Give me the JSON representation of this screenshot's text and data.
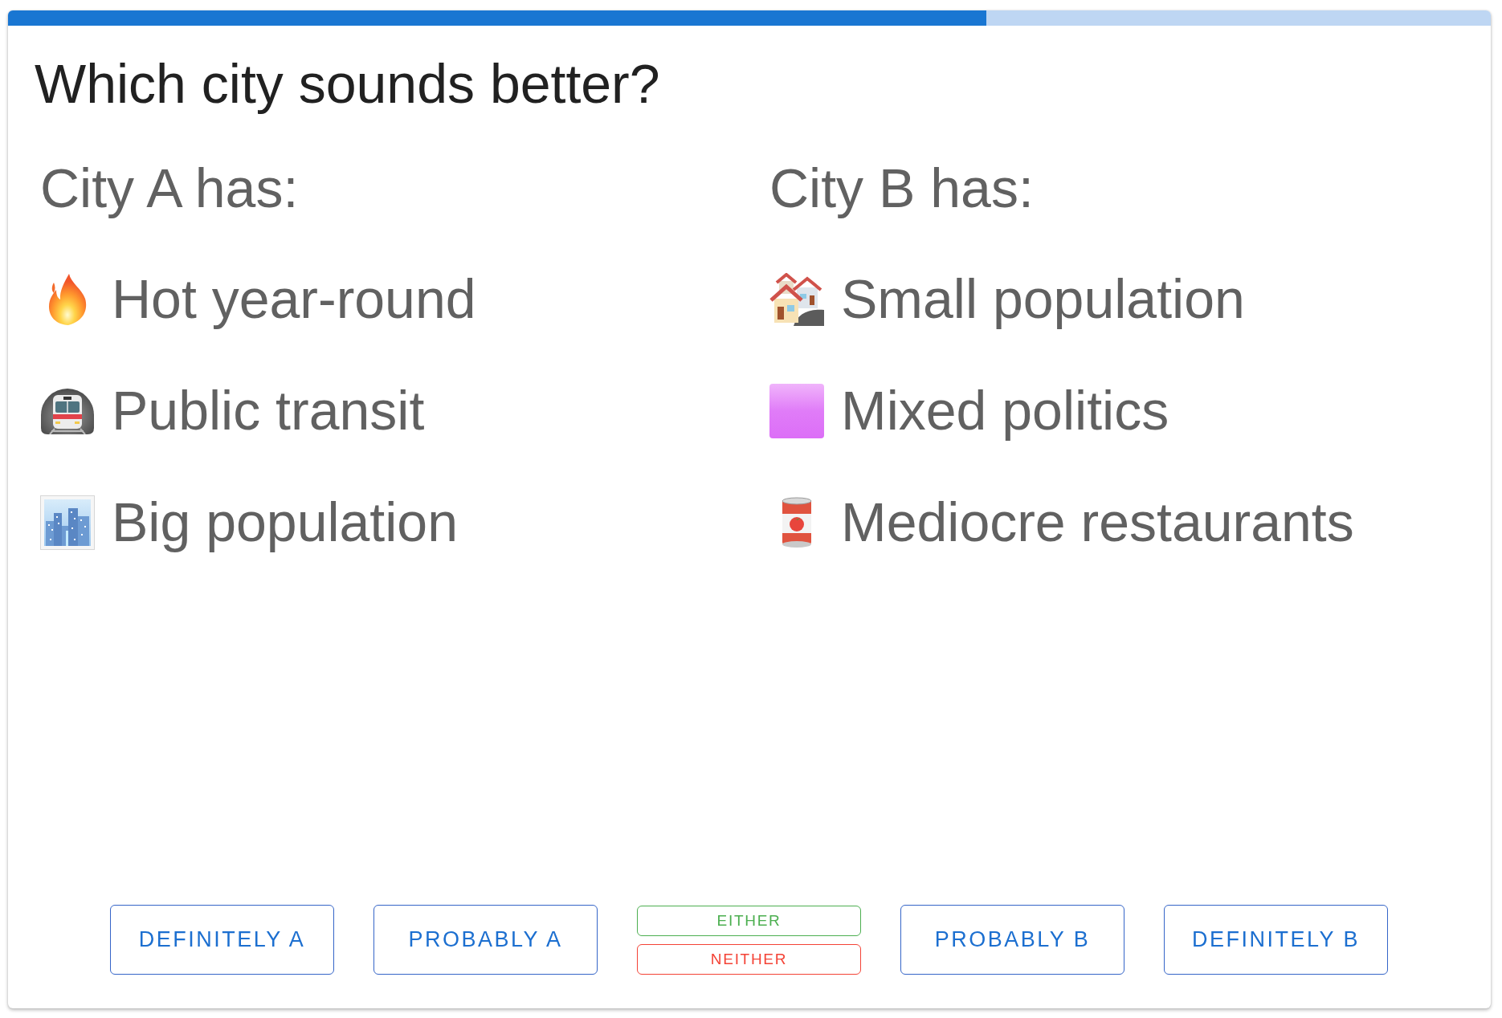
{
  "progress": {
    "level": 0.66
  },
  "question": "Which city sounds better?",
  "options": [
    {
      "heading": "City A has:",
      "traits": [
        {
          "kind": "fire",
          "label": "Hot year-round"
        },
        {
          "kind": "train",
          "label": "Public transit"
        },
        {
          "kind": "city",
          "label": "Big population"
        }
      ]
    },
    {
      "heading": "City B has:",
      "traits": [
        {
          "kind": "houses",
          "label": "Small population"
        },
        {
          "kind": "square",
          "label": "Mixed politics"
        },
        {
          "kind": "can",
          "label": "Mediocre restaurants"
        }
      ]
    }
  ],
  "answers": [
    {
      "kind": "main",
      "label": "DEFINITELY A"
    },
    {
      "kind": "main",
      "label": "PROBABLY A"
    },
    {
      "kind": "pair",
      "items": [
        {
          "label": "EITHER",
          "color": "#4caf50"
        },
        {
          "label": "NEITHER",
          "color": "#f44336"
        }
      ]
    },
    {
      "kind": "main",
      "label": "PROBABLY B"
    },
    {
      "kind": "main",
      "label": "DEFINITELY B"
    }
  ]
}
